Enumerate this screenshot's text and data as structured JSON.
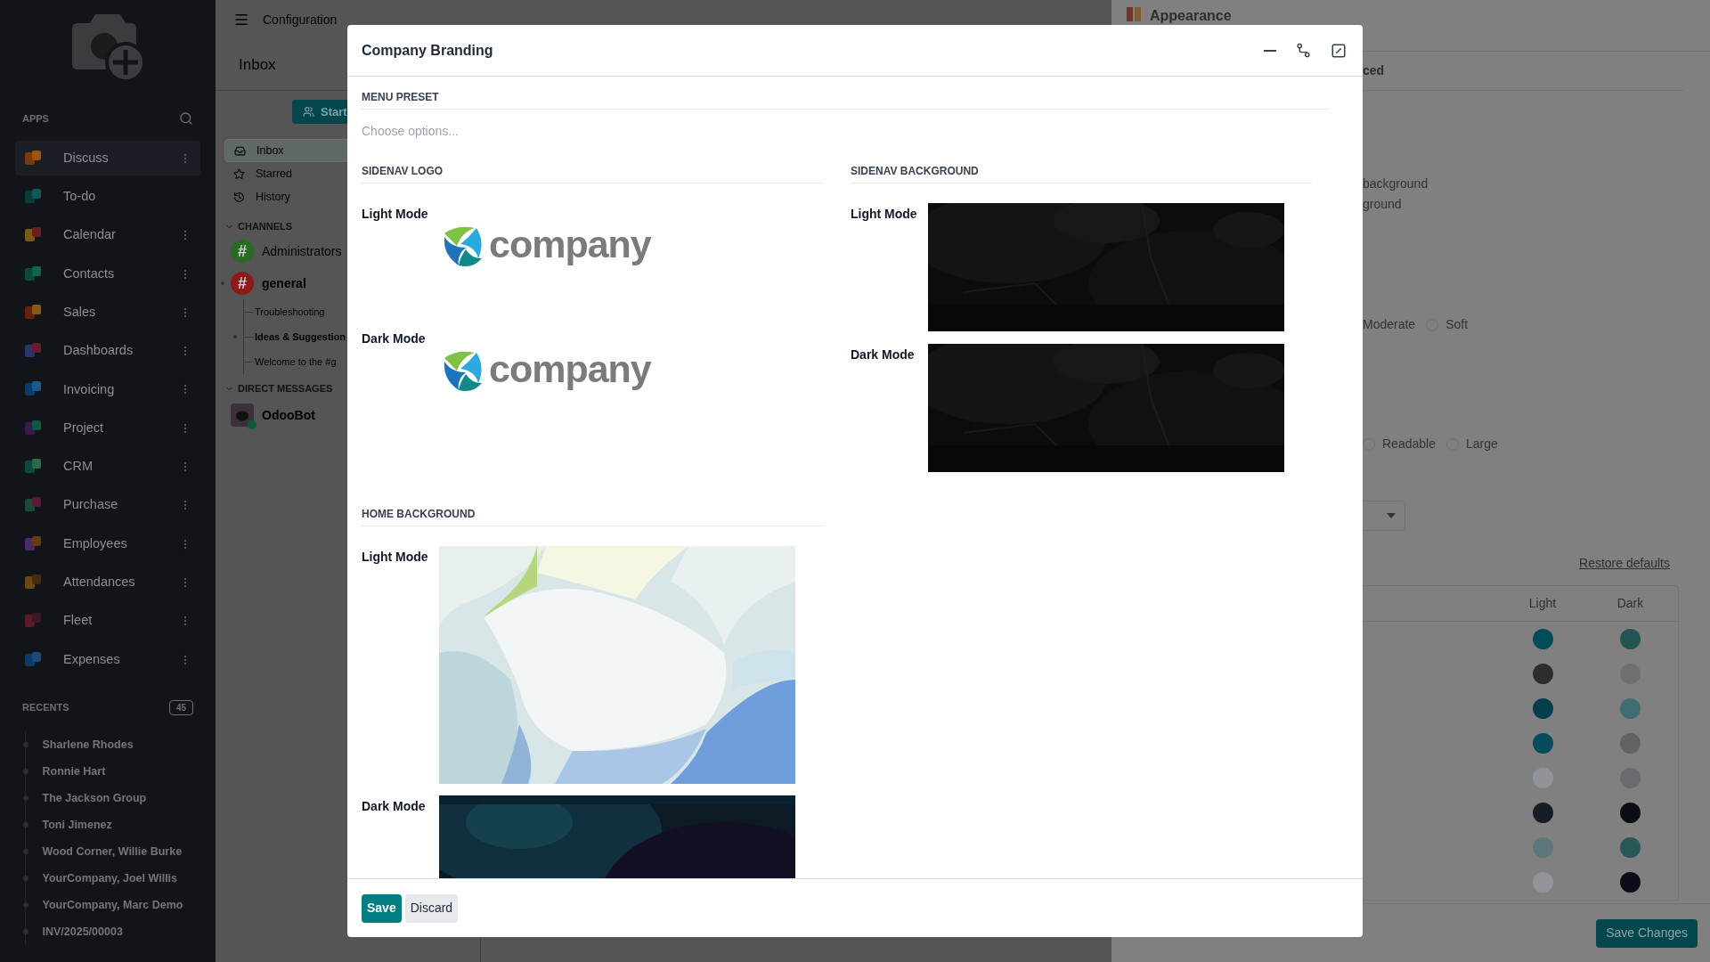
{
  "sidebar": {
    "apps_heading": "APPS",
    "apps": [
      {
        "label": "Discuss",
        "selected": true,
        "has_menu": true
      },
      {
        "label": "To-do",
        "selected": false,
        "has_menu": false
      },
      {
        "label": "Calendar",
        "selected": false,
        "has_menu": true
      },
      {
        "label": "Contacts",
        "selected": false,
        "has_menu": true
      },
      {
        "label": "Sales",
        "selected": false,
        "has_menu": true
      },
      {
        "label": "Dashboards",
        "selected": false,
        "has_menu": true
      },
      {
        "label": "Invoicing",
        "selected": false,
        "has_menu": true
      },
      {
        "label": "Project",
        "selected": false,
        "has_menu": true
      },
      {
        "label": "CRM",
        "selected": false,
        "has_menu": true
      },
      {
        "label": "Purchase",
        "selected": false,
        "has_menu": true
      },
      {
        "label": "Employees",
        "selected": false,
        "has_menu": true
      },
      {
        "label": "Attendances",
        "selected": false,
        "has_menu": true
      },
      {
        "label": "Fleet",
        "selected": false,
        "has_menu": true
      },
      {
        "label": "Expenses",
        "selected": false,
        "has_menu": true
      }
    ],
    "recents_heading": "RECENTS",
    "recents_count": "45",
    "recents": [
      "Sharlene Rhodes",
      "Ronnie Hart",
      "The Jackson Group",
      "Toni Jimenez",
      "Wood Corner, Willie Burke",
      "YourCompany, Joel Willis",
      "YourCompany, Marc Demo",
      "INV/2025/00003"
    ]
  },
  "topbar": {
    "breadcrumb": "Configuration"
  },
  "discuss": {
    "title": "Inbox",
    "start_button": "Start",
    "mailboxes": [
      {
        "label": "Inbox",
        "selected": true
      },
      {
        "label": "Starred",
        "selected": false
      },
      {
        "label": "History",
        "selected": false
      }
    ],
    "channels_heading": "CHANNELS",
    "channels": [
      {
        "name": "Administrators",
        "icon": "#",
        "color": "#2a6b22",
        "unread": false
      },
      {
        "name": "general",
        "icon": "#",
        "color": "#8b1a1a",
        "unread": true,
        "children": [
          {
            "name": "Troubleshooting",
            "unread": false
          },
          {
            "name": "Ideas & Suggestion",
            "unread": true
          },
          {
            "name": "Welcome to the #g",
            "unread": false
          }
        ]
      }
    ],
    "dm_heading": "DIRECT MESSAGES",
    "direct_messages": [
      {
        "name": "OdooBot",
        "online": true
      }
    ]
  },
  "settings_panel": {
    "title": "Appearance",
    "tab": "ced",
    "texts": [
      "background",
      "ground"
    ],
    "radio_groups": [
      [
        {
          "label": "Moderate"
        },
        {
          "label": "Soft",
          "selected": false
        }
      ],
      [
        {
          "label": "Readable",
          "selected": false
        },
        {
          "label": "Large",
          "selected": false
        }
      ]
    ],
    "restore_link": "Restore defaults",
    "color_table": {
      "columns": [
        "Light",
        "Dark"
      ],
      "rows": [
        {
          "swatches": [
            {
              "color": "#014d57"
            },
            {
              "color": "#255454"
            }
          ]
        },
        {
          "swatches": [
            {
              "color": "#2b2d31"
            },
            {
              "color": "#6f7073"
            }
          ]
        },
        {
          "swatches": [
            {
              "color": "#053f4a"
            },
            {
              "color": "#3f6e72"
            }
          ]
        },
        {
          "swatches": [
            {
              "color": "#064c5a"
            },
            {
              "color": "#626262"
            }
          ]
        },
        {
          "swatches": [
            {
              "color": "#909397"
            },
            {
              "color": "#6a6b70"
            }
          ]
        },
        {
          "swatches": [
            {
              "color": "#171d24"
            },
            {
              "color": "#0a0e14"
            }
          ]
        },
        {
          "swatches": [
            {
              "color": "#5f767b"
            },
            {
              "color": "#295758"
            }
          ]
        },
        {
          "swatches": [
            {
              "color": "#919498"
            },
            {
              "color": "#0b0e16"
            }
          ]
        }
      ]
    },
    "save_button": "Save Changes"
  },
  "dialog": {
    "title": "Company Branding",
    "menu_preset": {
      "heading": "MENU PRESET",
      "placeholder": "Choose options..."
    },
    "sidenav_logo": {
      "heading": "SIDENAV LOGO",
      "rows": [
        {
          "label": "Light Mode",
          "logo_text": "company"
        },
        {
          "label": "Dark Mode",
          "logo_text": "company"
        }
      ]
    },
    "sidenav_background": {
      "heading": "SIDENAV BACKGROUND",
      "rows": [
        {
          "label": "Light Mode",
          "kind": "picture"
        },
        {
          "label": "Dark Mode",
          "kind": "picture"
        }
      ]
    },
    "home_background": {
      "heading": "HOME BACKGROUND",
      "rows": [
        {
          "label": "Light Mode",
          "kind": "picture"
        },
        {
          "label": "Dark Mode",
          "kind": "picture"
        }
      ]
    },
    "buttons": [
      {
        "label": "Save",
        "primary": true
      },
      {
        "label": "Discard",
        "primary": false
      }
    ]
  }
}
